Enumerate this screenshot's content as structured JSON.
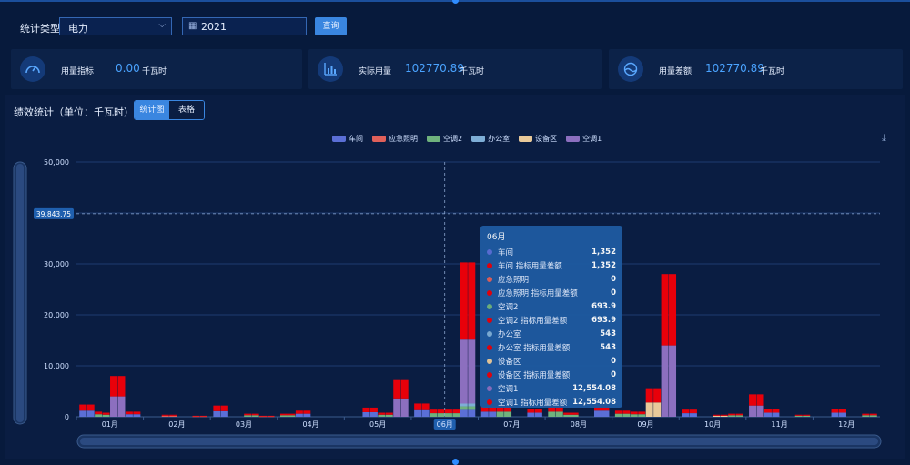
{
  "filter": {
    "type_label": "统计类型",
    "type_value": "电力",
    "date_value": "2021",
    "query_label": "查询"
  },
  "cards": [
    {
      "label": "用量指标",
      "value": "0.00",
      "unit": "千瓦时",
      "icon": "gauge-icon"
    },
    {
      "label": "实际用量",
      "value": "102770.89",
      "unit": "千瓦时",
      "icon": "bar-chart-icon"
    },
    {
      "label": "用量差额",
      "value": "102770.89",
      "unit": "千瓦时",
      "icon": "wave-icon"
    }
  ],
  "panel": {
    "title": "绩效统计（单位：千瓦时）",
    "tab_chart": "统计图",
    "tab_table": "表格"
  },
  "chart_data": {
    "type": "bar",
    "ylim": [
      0,
      50000
    ],
    "yticks": [
      "0",
      "10,000",
      "20,000",
      "30,000",
      "40,000",
      "50,000"
    ],
    "ytick_values": [
      0,
      10000,
      20000,
      30000,
      40000,
      50000
    ],
    "months": [
      "01月",
      "02月",
      "03月",
      "04月",
      "05月",
      "06月",
      "07月",
      "08月",
      "09月",
      "10月",
      "11月",
      "12月"
    ],
    "highlight_month": "06月",
    "crosshair_label": "39,843.75",
    "crosshair_value": 39843.75,
    "legend": [
      {
        "name": "车间",
        "color": "#5b6fd6"
      },
      {
        "name": "应急照明",
        "color": "#e0605a"
      },
      {
        "name": "空调2",
        "color": "#6fb27d"
      },
      {
        "name": "办公室",
        "color": "#7eaed6"
      },
      {
        "name": "设备区",
        "color": "#e8c99a"
      },
      {
        "name": "空调1",
        "color": "#8c6fbf"
      }
    ],
    "series_colors": [
      "#5b6fd6",
      "#e0605a",
      "#6fb27d",
      "#7eaed6",
      "#e8c99a",
      "#8c6fbf"
    ],
    "diff_color": "#e8000a",
    "bars": [
      [
        [
          1200,
          0,
          0,
          0,
          0,
          0
        ],
        [
          1200,
          0,
          0,
          0,
          0,
          0
        ],
        [
          0,
          0,
          500,
          0,
          0,
          0
        ],
        [
          0,
          0,
          400,
          0,
          0,
          0
        ],
        [
          0,
          0,
          0,
          0,
          0,
          4000
        ],
        [
          0,
          0,
          0,
          0,
          0,
          4000
        ],
        [
          500,
          0,
          0,
          0,
          0,
          0
        ],
        [
          500,
          0,
          0,
          0,
          0,
          0
        ]
      ],
      [
        [
          0,
          0,
          0,
          0,
          0,
          0
        ],
        [
          0,
          0,
          0,
          0,
          0,
          0
        ],
        [
          0,
          200,
          0,
          0,
          0,
          0
        ],
        [
          0,
          200,
          0,
          0,
          0,
          0
        ],
        [
          0,
          0,
          0,
          0,
          0,
          0
        ],
        [
          0,
          0,
          0,
          0,
          0,
          0
        ],
        [
          0,
          100,
          0,
          0,
          0,
          0
        ],
        [
          0,
          100,
          0,
          0,
          0,
          0
        ]
      ],
      [
        [
          1100,
          0,
          0,
          0,
          0,
          0
        ],
        [
          1100,
          0,
          0,
          0,
          0,
          0
        ],
        [
          0,
          0,
          0,
          0,
          0,
          0
        ],
        [
          0,
          0,
          0,
          0,
          0,
          0
        ],
        [
          0,
          0,
          300,
          0,
          0,
          0
        ],
        [
          0,
          0,
          300,
          0,
          0,
          0
        ],
        [
          0,
          100,
          0,
          0,
          0,
          0
        ],
        [
          0,
          100,
          0,
          0,
          0,
          0
        ]
      ],
      [
        [
          0,
          0,
          300,
          0,
          0,
          0
        ],
        [
          0,
          0,
          300,
          0,
          0,
          0
        ],
        [
          600,
          0,
          0,
          0,
          0,
          0
        ],
        [
          600,
          0,
          0,
          0,
          0,
          0
        ],
        [
          0,
          0,
          0,
          0,
          0,
          0
        ],
        [
          0,
          0,
          0,
          0,
          0,
          0
        ],
        [
          0,
          0,
          0,
          0,
          0,
          0
        ],
        [
          0,
          0,
          0,
          0,
          0,
          0
        ]
      ],
      [
        [
          0,
          0,
          0,
          0,
          0,
          0
        ],
        [
          0,
          0,
          0,
          0,
          0,
          0
        ],
        [
          900,
          0,
          0,
          0,
          0,
          0
        ],
        [
          900,
          0,
          0,
          0,
          0,
          0
        ],
        [
          0,
          0,
          400,
          0,
          0,
          0
        ],
        [
          0,
          0,
          400,
          0,
          0,
          0
        ],
        [
          0,
          0,
          0,
          0,
          0,
          3600
        ],
        [
          0,
          0,
          0,
          0,
          0,
          3600
        ]
      ],
      [
        [
          1300,
          0,
          0,
          0,
          0,
          0
        ],
        [
          1300,
          0,
          0,
          0,
          0,
          0
        ],
        [
          0,
          0,
          700,
          0,
          0,
          0
        ],
        [
          0,
          0,
          700,
          0,
          0,
          0
        ],
        [
          0,
          0,
          700,
          0,
          0,
          0
        ],
        [
          0,
          0,
          700,
          0,
          0,
          0
        ],
        [
          1352,
          0,
          693.9,
          543,
          0,
          12554.08
        ],
        [
          1352,
          0,
          693.9,
          543,
          0,
          12554.08
        ]
      ],
      [
        [
          1000,
          0,
          0,
          0,
          0,
          0
        ],
        [
          1000,
          0,
          0,
          0,
          0,
          0
        ],
        [
          0,
          0,
          1000,
          0,
          0,
          0
        ],
        [
          0,
          0,
          1000,
          0,
          0,
          0
        ],
        [
          0,
          0,
          0,
          0,
          0,
          0
        ],
        [
          0,
          0,
          0,
          0,
          0,
          0
        ],
        [
          800,
          0,
          0,
          0,
          0,
          0
        ],
        [
          800,
          0,
          0,
          0,
          0,
          0
        ]
      ],
      [
        [
          0,
          0,
          1000,
          0,
          0,
          0
        ],
        [
          0,
          0,
          1000,
          0,
          0,
          0
        ],
        [
          0,
          0,
          400,
          0,
          0,
          0
        ],
        [
          0,
          0,
          400,
          0,
          0,
          0
        ],
        [
          0,
          0,
          0,
          0,
          0,
          0
        ],
        [
          0,
          0,
          0,
          0,
          0,
          0
        ],
        [
          1200,
          0,
          0,
          0,
          0,
          0
        ],
        [
          1200,
          0,
          0,
          0,
          0,
          0
        ]
      ],
      [
        [
          0,
          0,
          600,
          0,
          0,
          0
        ],
        [
          0,
          0,
          600,
          0,
          0,
          0
        ],
        [
          0,
          0,
          500,
          0,
          0,
          0
        ],
        [
          0,
          0,
          500,
          0,
          0,
          0
        ],
        [
          0,
          0,
          0,
          0,
          2800,
          0
        ],
        [
          0,
          0,
          0,
          0,
          2800,
          0
        ],
        [
          0,
          0,
          0,
          0,
          0,
          14000
        ],
        [
          0,
          0,
          0,
          0,
          0,
          14000
        ]
      ],
      [
        [
          700,
          0,
          0,
          0,
          0,
          0
        ],
        [
          700,
          0,
          0,
          0,
          0,
          0
        ],
        [
          0,
          0,
          0,
          0,
          0,
          0
        ],
        [
          0,
          0,
          0,
          0,
          0,
          0
        ],
        [
          0,
          0,
          0,
          0,
          200,
          0
        ],
        [
          0,
          0,
          0,
          0,
          200,
          0
        ],
        [
          0,
          0,
          300,
          0,
          0,
          0
        ],
        [
          0,
          0,
          300,
          0,
          0,
          0
        ]
      ],
      [
        [
          0,
          0,
          0,
          0,
          0,
          2200
        ],
        [
          0,
          0,
          0,
          0,
          0,
          2200
        ],
        [
          800,
          0,
          0,
          0,
          0,
          0
        ],
        [
          800,
          0,
          0,
          0,
          0,
          0
        ],
        [
          0,
          0,
          0,
          0,
          0,
          0
        ],
        [
          0,
          0,
          0,
          0,
          0,
          0
        ],
        [
          0,
          0,
          200,
          0,
          0,
          0
        ],
        [
          0,
          0,
          200,
          0,
          0,
          0
        ]
      ],
      [
        [
          0,
          0,
          0,
          0,
          0,
          0
        ],
        [
          0,
          0,
          0,
          0,
          0,
          0
        ],
        [
          800,
          0,
          0,
          0,
          0,
          0
        ],
        [
          800,
          0,
          0,
          0,
          0,
          0
        ],
        [
          0,
          0,
          0,
          0,
          0,
          0
        ],
        [
          0,
          0,
          0,
          0,
          0,
          0
        ],
        [
          0,
          0,
          300,
          0,
          0,
          0
        ],
        [
          0,
          0,
          300,
          0,
          0,
          0
        ]
      ]
    ],
    "tooltip": {
      "title": "06月",
      "rows": [
        {
          "name": "车间",
          "value": "1,352",
          "color": "#5b6fd6"
        },
        {
          "name": "车间 指标用量差额",
          "value": "1,352",
          "color": "#e8000a"
        },
        {
          "name": "应急照明",
          "value": "0",
          "color": "#e0605a"
        },
        {
          "name": "应急照明 指标用量差额",
          "value": "0",
          "color": "#e8000a"
        },
        {
          "name": "空调2",
          "value": "693.9",
          "color": "#6fb27d"
        },
        {
          "name": "空调2 指标用量差额",
          "value": "693.9",
          "color": "#e8000a"
        },
        {
          "name": "办公室",
          "value": "543",
          "color": "#7eaed6"
        },
        {
          "name": "办公室 指标用量差额",
          "value": "543",
          "color": "#e8000a"
        },
        {
          "name": "设备区",
          "value": "0",
          "color": "#e8c99a"
        },
        {
          "name": "设备区 指标用量差额",
          "value": "0",
          "color": "#e8000a"
        },
        {
          "name": "空调1",
          "value": "12,554.08",
          "color": "#8c6fbf"
        },
        {
          "name": "空调1 指标用量差额",
          "value": "12,554.08",
          "color": "#e8000a"
        }
      ]
    }
  }
}
